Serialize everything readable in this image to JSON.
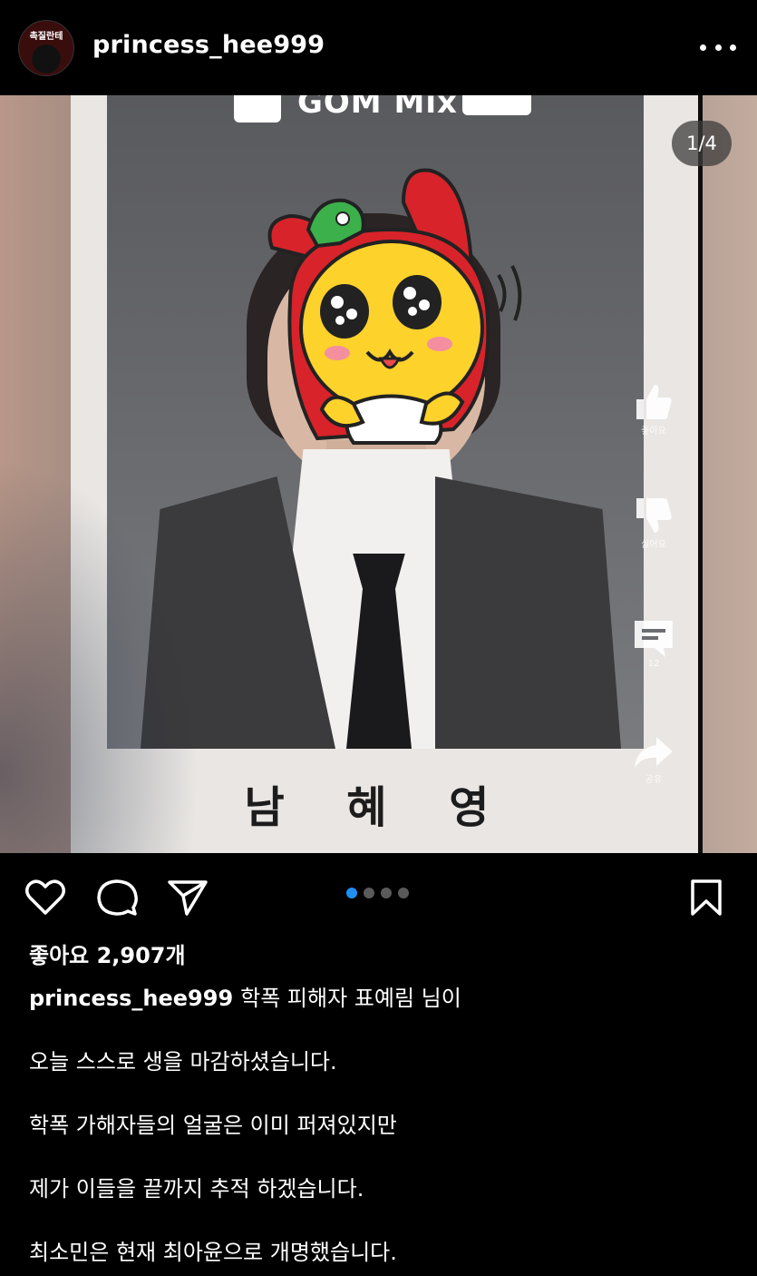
{
  "header": {
    "avatar_text": "촉질란테",
    "username": "princess_hee999"
  },
  "photo": {
    "logo_text": "GOM Mix",
    "counter": "1/4",
    "name_text": "남 혜 영",
    "side_actions": [
      {
        "icon": "thumbs-up-icon",
        "label": "좋아요"
      },
      {
        "icon": "thumbs-down-icon",
        "label": "싫어요"
      },
      {
        "icon": "comment-icon",
        "label": "12"
      },
      {
        "icon": "share-icon",
        "label": "공유"
      }
    ]
  },
  "carousel": {
    "total": 4,
    "active_index": 0,
    "active_color": "#1e8ff1"
  },
  "likes": "좋아요 2,907개",
  "caption": {
    "username": "princess_hee999",
    "first_line": "학폭 피해자 표예림 님이",
    "lines": [
      "오늘 스스로 생을 마감하셨습니다.",
      "학폭 가해자들의 얼굴은 이미 퍼져있지만",
      "제가 이들을 끝까지 추적 하겠습니다.",
      "최소민은 현재 최아윤으로 개명했습니다."
    ]
  }
}
